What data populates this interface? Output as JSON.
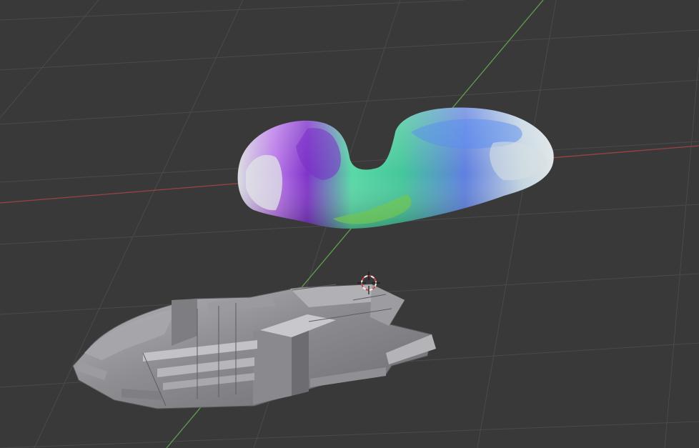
{
  "viewport": {
    "kind": "3d-viewport",
    "background_color": "#393939",
    "grid_color": "#4a4a4a",
    "x_axis_color": "#9a4343",
    "y_axis_color": "#5f9f4f",
    "objects": [
      {
        "name": "smooth-colored-mesh",
        "shading": "normal-map-colors",
        "colors": [
          "#b070e0",
          "#7a2fc8",
          "#58e6a6",
          "#4a57d6",
          "#cfd5d8",
          "#74c84f"
        ]
      },
      {
        "name": "grey-frame-mesh",
        "shading": "flat-grey",
        "colors": [
          "#8a8a8e",
          "#aeaeb2",
          "#5f5f63",
          "#c8c8cc"
        ]
      }
    ],
    "cursor": {
      "name": "3d-cursor",
      "colors": [
        "#d44444",
        "#f2f2f2"
      ]
    }
  }
}
